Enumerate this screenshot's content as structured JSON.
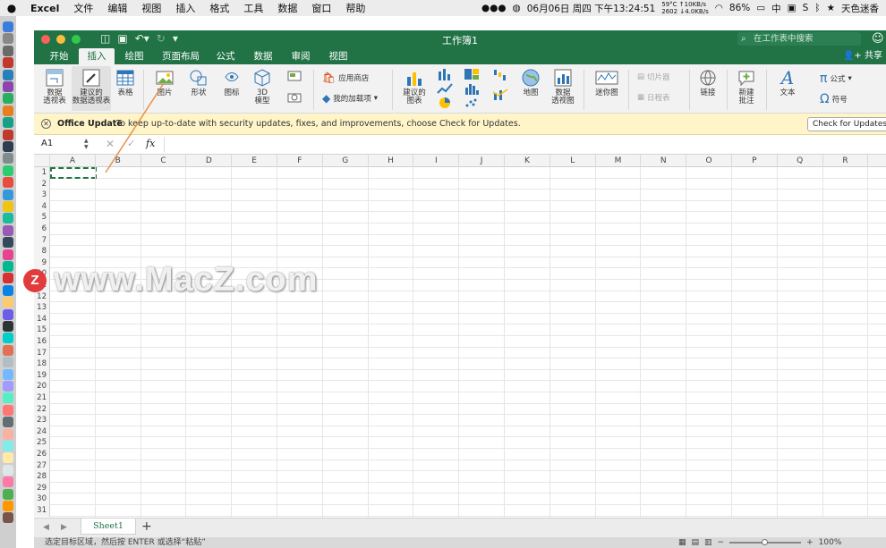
{
  "menubar": {
    "apple": "",
    "items": [
      "Excel",
      "文件",
      "编辑",
      "视图",
      "插入",
      "格式",
      "工具",
      "数据",
      "窗口",
      "帮助"
    ],
    "temp": "59°C",
    "rpm": "2602",
    "up": "↑10KB/s",
    "down": "↓4.0KB/s",
    "clock": "06月06日 周四 下午13:24:51",
    "battery": "86%",
    "input_method": "中",
    "user": "天色迷香"
  },
  "window": {
    "title": "工作簿1",
    "search_placeholder": "在工作表中搜索",
    "share": "共享",
    "tabs": [
      "开始",
      "插入",
      "绘图",
      "页面布局",
      "公式",
      "数据",
      "审阅",
      "视图"
    ],
    "active_tab": "插入",
    "accent": "#217346"
  },
  "ribbon": {
    "pivot_table": "数据\n透视表",
    "recommended_pivot": "建议的\n数据透视表",
    "table": "表格",
    "pictures": "图片",
    "shapes": "形状",
    "icons": "图标",
    "models_3d": "3D\n模型",
    "app_store": "应用商店",
    "my_addins": "我的加载项",
    "recommended_charts": "建议的\n图表",
    "maps": "地图",
    "pivot_chart": "数据\n透视图",
    "sparklines": "迷你图",
    "slicer": "切片器",
    "timeline": "日程表",
    "link": "链接",
    "new_comment": "新建\n批注",
    "text": "文本",
    "equation": "公式",
    "symbol": "符号"
  },
  "message_bar": {
    "title": "Office Update",
    "text": "To keep up-to-date with security updates, fixes, and improvements, choose Check for Updates.",
    "button": "Check for Updates"
  },
  "formula_bar": {
    "name_box": "A1",
    "cancel": "✕",
    "enter": "✓",
    "fx": "fx",
    "formula": ""
  },
  "grid": {
    "columns": [
      "A",
      "B",
      "C",
      "D",
      "E",
      "F",
      "G",
      "H",
      "I",
      "J",
      "K",
      "L",
      "M",
      "N",
      "O",
      "P",
      "Q",
      "R"
    ],
    "rows": [
      "1",
      "2",
      "3",
      "4",
      "5",
      "6",
      "7",
      "8",
      "9",
      "10",
      "11",
      "12",
      "13",
      "14",
      "15",
      "16",
      "17",
      "18",
      "19",
      "20",
      "21",
      "22",
      "23",
      "24",
      "25",
      "26",
      "27",
      "28",
      "29",
      "30",
      "31"
    ],
    "selected_cell": "A1"
  },
  "watermark": {
    "badge": "Z",
    "text": "www.MacZ.com"
  },
  "sheets": {
    "tabs": [
      "Sheet1"
    ],
    "add": "+"
  },
  "status": {
    "text": "选定目标区域，然后按 ENTER 或选择“粘贴”",
    "zoom": "100%",
    "zoom_minus": "−",
    "zoom_plus": "+"
  }
}
